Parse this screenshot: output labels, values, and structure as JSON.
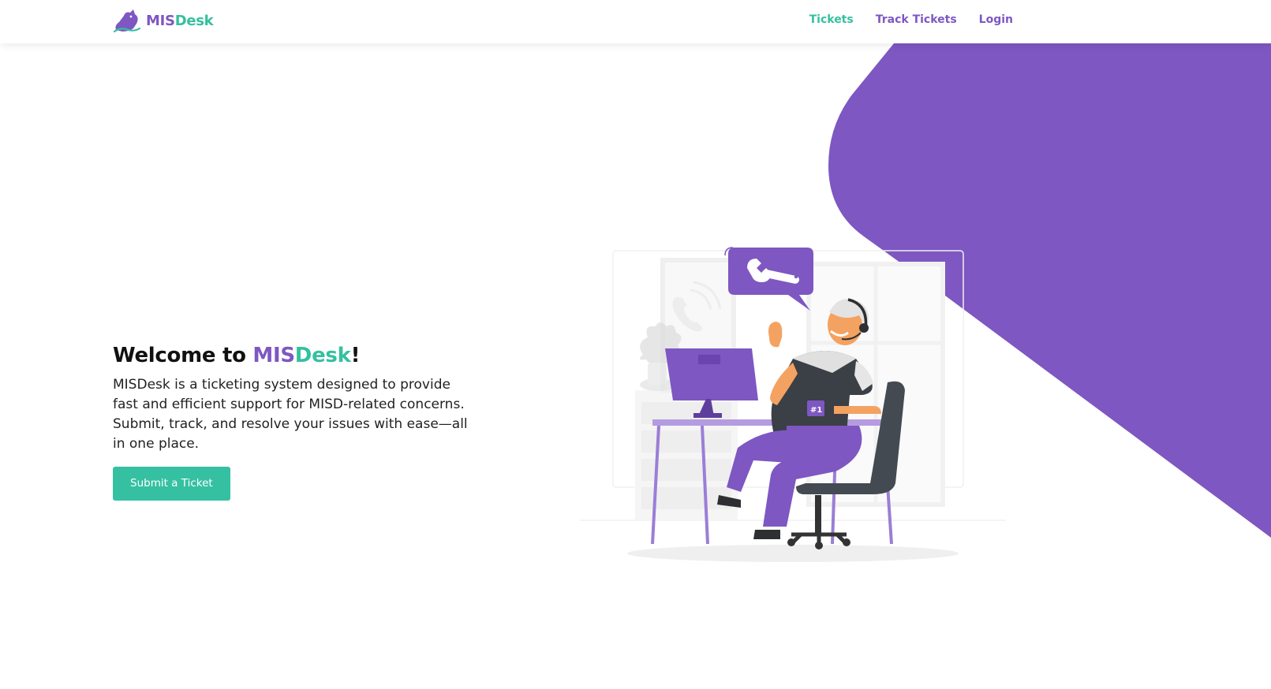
{
  "navbar": {
    "brand_part1": "MIS",
    "brand_part2": "Desk",
    "links": [
      {
        "label": "Tickets"
      },
      {
        "label": "Track Tickets"
      },
      {
        "label": "Login"
      }
    ]
  },
  "hero": {
    "title_prefix": "Welcome to ",
    "title_brand1": "MIS",
    "title_brand2": "Desk",
    "title_suffix": "!",
    "description": "MISDesk is a ticketing system designed to provide fast and efficient support for MISD-related concerns. Submit, track, and resolve your issues with ease—all in one place.",
    "cta_label": "Submit a Ticket"
  },
  "illustration": {
    "mug_label": "#1"
  },
  "colors": {
    "brand_purple": "#7e57c2",
    "brand_teal": "#35c0a0",
    "cta": "#36c0a2"
  },
  "icons": [
    "brand-logo-icon",
    "wrench-icon",
    "phone-icon"
  ]
}
